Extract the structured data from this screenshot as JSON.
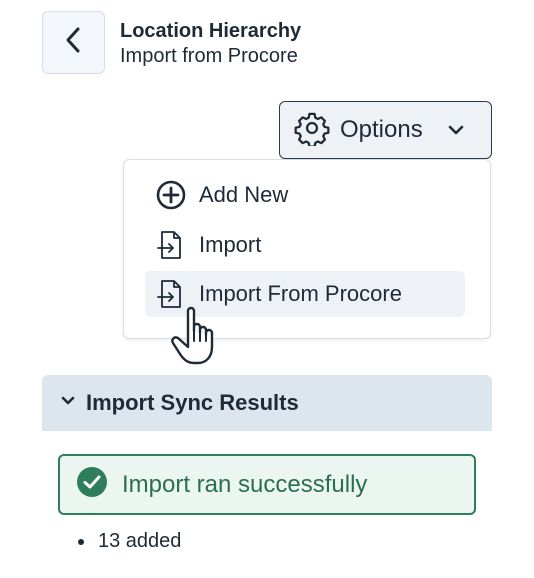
{
  "header": {
    "title": "Location Hierarchy",
    "subtitle": "Import from Procore",
    "back_icon": "chevron-left-icon"
  },
  "options": {
    "label": "Options",
    "icon": "gear-icon",
    "chevron_icon": "chevron-down-icon"
  },
  "menu": {
    "items": [
      {
        "label": "Add New",
        "icon": "plus-circle-icon"
      },
      {
        "label": "Import",
        "icon": "file-import-icon"
      },
      {
        "label": "Import From Procore",
        "icon": "file-import-icon",
        "hovered": true
      }
    ]
  },
  "sync_results": {
    "title": "Import Sync Results",
    "chevron_icon": "chevron-down-icon",
    "status": "Import ran successfully",
    "status_icon": "check-circle-icon",
    "status_color": "#2e7d5b",
    "results": [
      "13 added"
    ]
  },
  "colors": {
    "text": "#1f2a37",
    "header_bg": "#dde5ef",
    "success_bg": "#ecf6f0",
    "success_border": "#2e7d5b"
  }
}
